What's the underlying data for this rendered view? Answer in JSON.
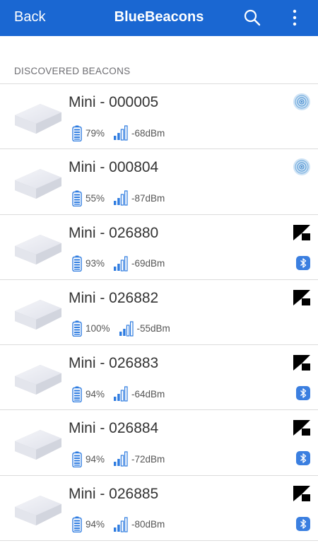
{
  "nav": {
    "back_label": "Back",
    "title": "BlueBeacons"
  },
  "section_header": "DISCOVERED BEACONS",
  "colors": {
    "nav_bg": "#1a67d2",
    "accent": "#1a67d2",
    "divider": "#dcdcdc"
  },
  "beacons": [
    {
      "name": "Mini - 000005",
      "battery": "79%",
      "signal": "-68dBm",
      "type_icon": "eddystone-icon",
      "bluetooth": false
    },
    {
      "name": "Mini - 000804",
      "battery": "55%",
      "signal": "-87dBm",
      "type_icon": "eddystone-icon",
      "bluetooth": false
    },
    {
      "name": "Mini - 026880",
      "battery": "93%",
      "signal": "-69dBm",
      "type_icon": "beacon-brand-icon",
      "bluetooth": true
    },
    {
      "name": "Mini - 026882",
      "battery": "100%",
      "signal": "-55dBm",
      "type_icon": "beacon-brand-icon",
      "bluetooth": false
    },
    {
      "name": "Mini - 026883",
      "battery": "94%",
      "signal": "-64dBm",
      "type_icon": "beacon-brand-icon",
      "bluetooth": true
    },
    {
      "name": "Mini - 026884",
      "battery": "94%",
      "signal": "-72dBm",
      "type_icon": "beacon-brand-icon",
      "bluetooth": true
    },
    {
      "name": "Mini - 026885",
      "battery": "94%",
      "signal": "-80dBm",
      "type_icon": "beacon-brand-icon",
      "bluetooth": true
    }
  ]
}
